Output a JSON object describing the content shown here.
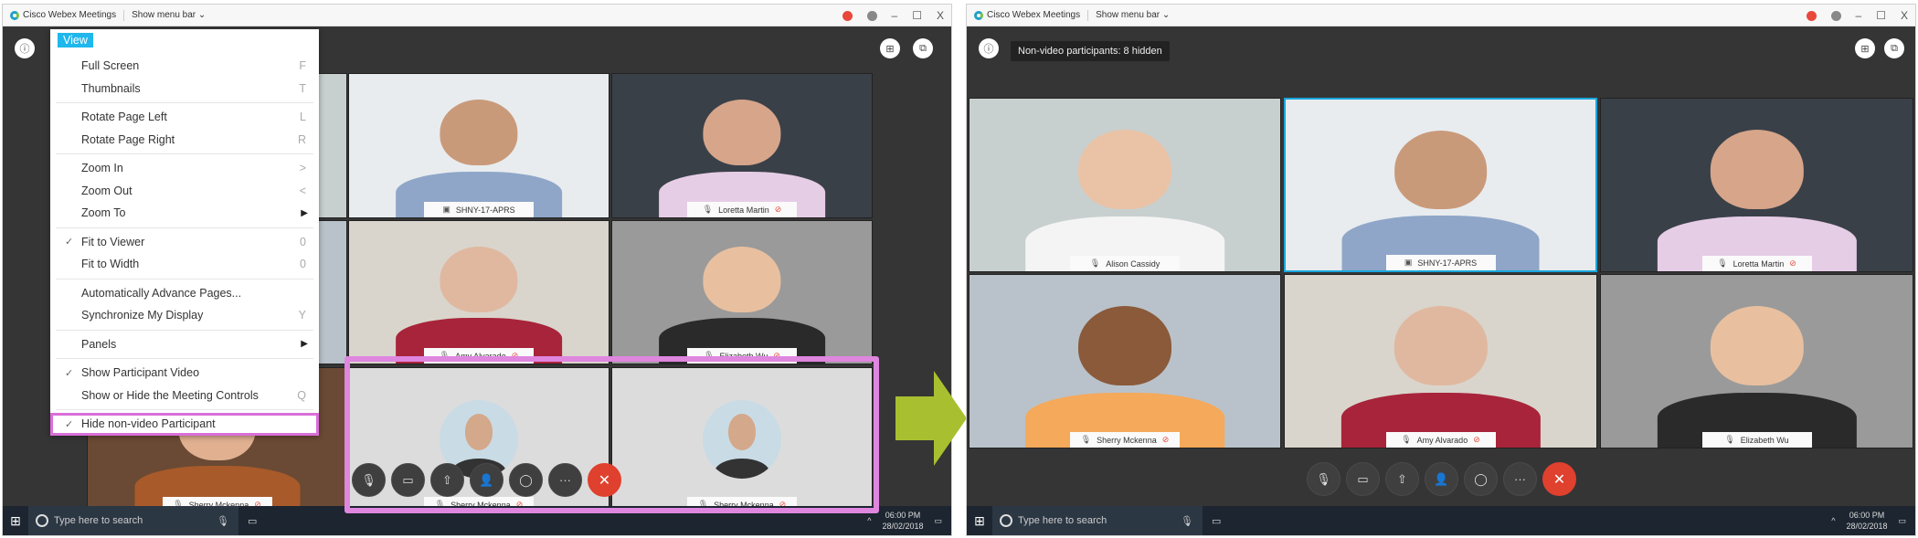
{
  "app_title": "Cisco Webex Meetings",
  "show_menu_bar": "Show menu bar",
  "window_controls": {
    "minimize": "–",
    "maximize": "☐",
    "close": "X"
  },
  "menu": {
    "title": "View",
    "groups": [
      [
        {
          "label": "Full Screen",
          "shortcut": "F"
        },
        {
          "label": "Thumbnails",
          "shortcut": "T"
        }
      ],
      [
        {
          "label": "Rotate Page Left",
          "shortcut": "L"
        },
        {
          "label": "Rotate Page Right",
          "shortcut": "R"
        }
      ],
      [
        {
          "label": "Zoom In",
          "shortcut": ">"
        },
        {
          "label": "Zoom Out",
          "shortcut": "<"
        },
        {
          "label": "Zoom To",
          "submenu": true
        }
      ],
      [
        {
          "label": "Fit to Viewer",
          "shortcut": "0",
          "checked": true
        },
        {
          "label": "Fit to Width",
          "shortcut": "0"
        }
      ],
      [
        {
          "label": "Automatically Advance Pages..."
        },
        {
          "label": "Synchronize My Display",
          "shortcut": "Y"
        }
      ],
      [
        {
          "label": "Panels",
          "submenu": true
        }
      ],
      [
        {
          "label": "Show Participant Video",
          "checked": true
        },
        {
          "label": "Show or Hide the Meeting Controls",
          "shortcut": "Q"
        }
      ],
      [
        {
          "label": "Hide non-video Participant",
          "checked": true,
          "highlighted": true
        }
      ]
    ]
  },
  "left_tiles": [
    {
      "bg": "#c8cfcf",
      "skin": "#e0c0a0",
      "cloth": "#f0f0f0"
    },
    {
      "label": "SHNY-17-APRS",
      "icon": "room",
      "bg": "#e8ecef",
      "skin": "#c99a7a",
      "cloth": "#8fa6c8"
    },
    {
      "label": "Loretta Martin",
      "icon": "mic",
      "muted": true,
      "bg": "#3a4048",
      "skin": "#d6a58a",
      "cloth": "#e6cde6"
    },
    {
      "bg": "#b9c2ca",
      "skin": "#8a5a3a",
      "cloth": "#f5a95a"
    },
    {
      "label": "Amy Alvarado",
      "icon": "mic",
      "muted": true,
      "bg": "#d9d5cc",
      "skin": "#e0b8a0",
      "cloth": "#a8243a"
    },
    {
      "label": "Elizabeth Wu",
      "icon": "mic",
      "muted": true,
      "bg": "#9a9a9a",
      "skin": "#e8c0a0",
      "cloth": "#2a2a2a"
    },
    {
      "label": "Sherry Mckenna",
      "icon": "mic",
      "muted": true,
      "bg": "#6a4a34",
      "skin": "#e0b090",
      "cloth": "#a85a2a"
    },
    {
      "label": "Sherry Mckenna",
      "icon": "mic",
      "muted": true,
      "nonvideo": true,
      "bg": "#dcdcdc"
    },
    {
      "label": "Sherry Mckenna",
      "icon": "mic",
      "muted": true,
      "nonvideo": true,
      "bg": "#dcdcdc"
    }
  ],
  "right_tiles": [
    {
      "label": "Alison Cassidy",
      "icon": "mic",
      "bg": "#c8cfcf",
      "skin": "#eac3a6",
      "cloth": "#f4f4f4"
    },
    {
      "label": "SHNY-17-APRS",
      "icon": "room",
      "selected": true,
      "bg": "#e8ecef",
      "skin": "#c99a7a",
      "cloth": "#8fa6c8"
    },
    {
      "label": "Loretta Martin",
      "icon": "mic",
      "muted": true,
      "bg": "#3a4048",
      "skin": "#d6a58a",
      "cloth": "#e6cde6"
    },
    {
      "label": "Sherry Mckenna",
      "icon": "mic",
      "muted": true,
      "bg": "#b9c2ca",
      "skin": "#8a5a3a",
      "cloth": "#f5a95a"
    },
    {
      "label": "Amy Alvarado",
      "icon": "mic",
      "muted": true,
      "bg": "#d9d5cc",
      "skin": "#e0b8a0",
      "cloth": "#a8243a"
    },
    {
      "label": "Elizabeth Wu",
      "icon": "mic",
      "bg": "#9a9a9a",
      "skin": "#e8c0a0",
      "cloth": "#2a2a2a"
    }
  ],
  "controls": [
    {
      "name": "mute",
      "glyph": "🎙"
    },
    {
      "name": "video",
      "glyph": "▭"
    },
    {
      "name": "share",
      "glyph": "⇧"
    },
    {
      "name": "participants",
      "glyph": "👤"
    },
    {
      "name": "chat",
      "glyph": "◯"
    },
    {
      "name": "more",
      "glyph": "···"
    },
    {
      "name": "end-meeting",
      "glyph": "✕"
    }
  ],
  "non_video_notice": "Non-video participants: 8 hidden",
  "taskbar": {
    "search_placeholder": "Type here to search",
    "time": "06:00 PM",
    "date": "28/02/2018"
  },
  "colors": {
    "accent": "#1fb7ec",
    "highlight": "#df86df",
    "end": "#e0402e",
    "arrow": "#a8c030"
  }
}
